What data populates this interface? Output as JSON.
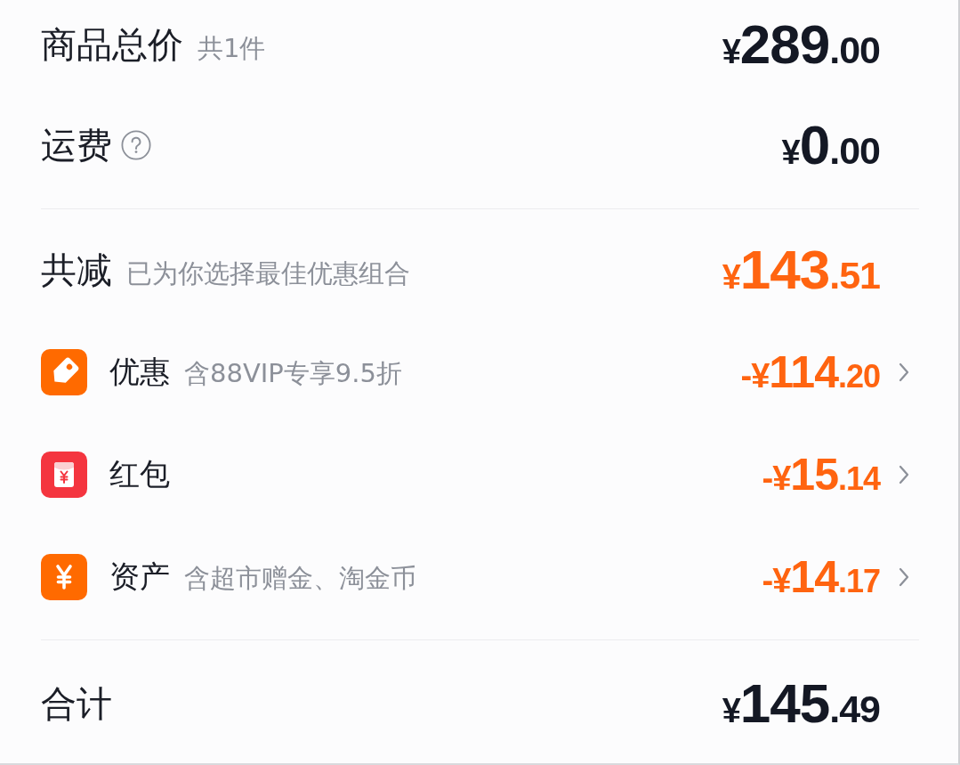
{
  "totals": [
    {
      "label": "商品总价",
      "hint": "共1件",
      "help": false,
      "amount": "¥289.00"
    },
    {
      "label": "运费",
      "help": true,
      "amount": "¥0.00"
    }
  ],
  "discount": {
    "label": "共减",
    "hint": "已为你选择最佳优惠组合",
    "amount": "¥143.51"
  },
  "deductions": [
    {
      "kind": "coupon",
      "color": "#ff6a00",
      "label": "优惠",
      "hint": "含88VIP专享9.5折",
      "amount": "-¥114.20"
    },
    {
      "kind": "red-packet",
      "color": "#f4353f",
      "label": "红包",
      "amount": "-¥15.14"
    },
    {
      "kind": "assets",
      "color": "#ff6a00",
      "label": "资产",
      "hint": "含超市赠金、淘金币",
      "amount": "-¥14.17"
    }
  ],
  "total": {
    "label": "合计",
    "amount": "¥145.49"
  }
}
